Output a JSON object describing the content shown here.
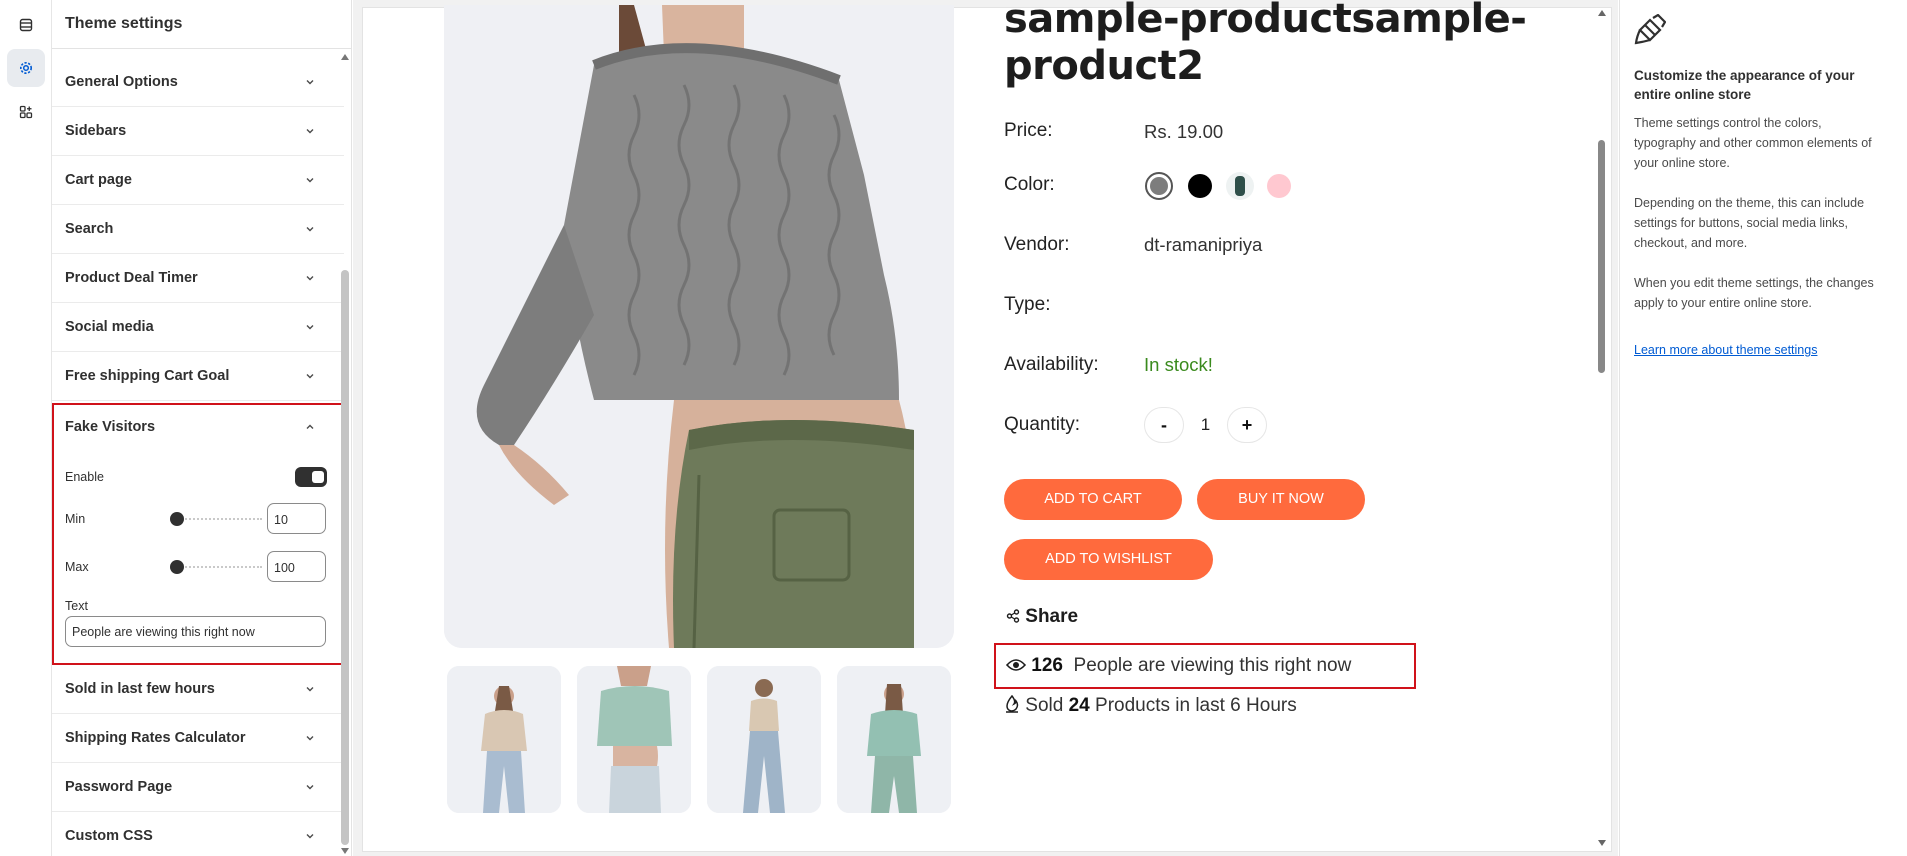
{
  "sidebar": {
    "title": "Theme settings",
    "sections": [
      {
        "label": "General Options"
      },
      {
        "label": "Sidebars"
      },
      {
        "label": "Cart page"
      },
      {
        "label": "Search"
      },
      {
        "label": "Product Deal Timer"
      },
      {
        "label": "Social media"
      },
      {
        "label": "Free shipping Cart Goal"
      },
      {
        "label": "Sold in last few hours"
      },
      {
        "label": "Shipping Rates Calculator"
      },
      {
        "label": "Password Page"
      },
      {
        "label": "Custom CSS"
      }
    ],
    "fake_visitors": {
      "label": "Fake Visitors",
      "enable_label": "Enable",
      "enabled": true,
      "min_label": "Min",
      "min_value": "10",
      "max_label": "Max",
      "max_value": "100",
      "text_label": "Text",
      "text_value": "People are viewing this right now"
    }
  },
  "product": {
    "title_line1": "sample-productsample-",
    "title_line2": "product2",
    "price_label": "Price:",
    "price_value": "Rs. 19.00",
    "color_label": "Color:",
    "vendor_label": "Vendor:",
    "vendor_value": "dt-ramanipriya",
    "type_label": "Type:",
    "availability_label": "Availability:",
    "availability_value": "In stock!",
    "quantity_label": "Quantity:",
    "quantity_minus": "-",
    "quantity_value": "1",
    "quantity_plus": "+",
    "add_to_cart": "ADD TO CART",
    "buy_it_now": "BUY IT NOW",
    "add_to_wishlist": "ADD TO WISHLIST",
    "share_label": "Share",
    "viewers_count": "126",
    "viewers_text": "People are viewing this right now",
    "sold_prefix": "Sold",
    "sold_count": "24",
    "sold_suffix": "Products in last 6 Hours",
    "swatch_colors": [
      "#7d7d7d",
      "#000000",
      "#2f4f4a",
      "#ffc8d0"
    ]
  },
  "info_panel": {
    "heading": "Customize the appearance of your entire online store",
    "p1": "Theme settings control the colors, typography and other common elements of your online store.",
    "p2": "Depending on the theme, this can include settings for buttons, social media links, checkout, and more.",
    "p3": "When you edit theme settings, the changes apply to your entire online store.",
    "link": "Learn more about theme settings"
  },
  "colors": {
    "accent_button": "#ff6a3d",
    "highlight_border": "#d0121a",
    "in_stock": "#3a8a1d",
    "link": "#005bd3"
  }
}
